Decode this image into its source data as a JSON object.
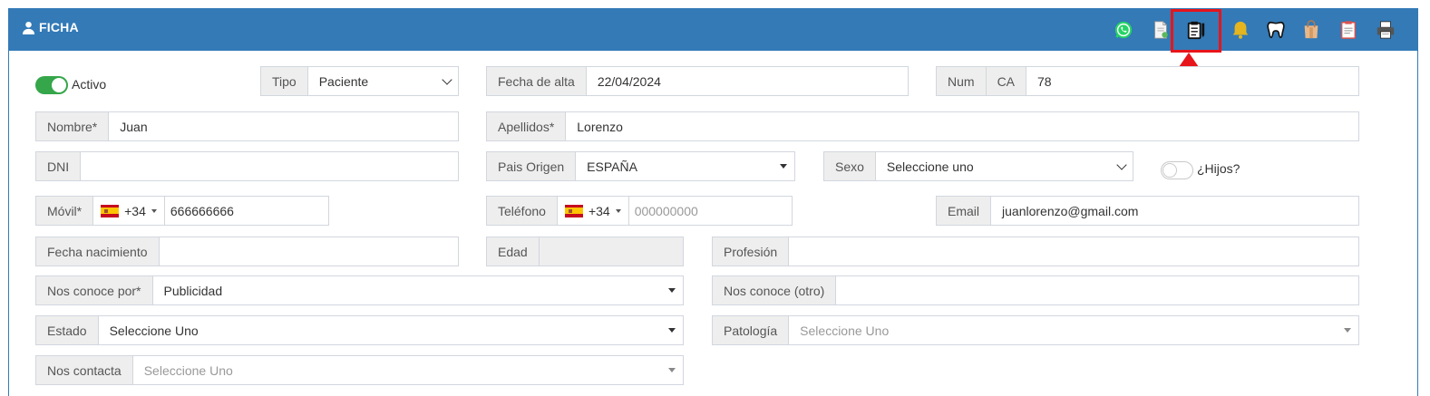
{
  "header": {
    "title": "FICHA",
    "icons": [
      "whatsapp-icon",
      "document-icon",
      "clipboard-edit-icon",
      "bell-icon",
      "tooth-icon",
      "bag-icon",
      "clipboard-list-icon",
      "printer-icon"
    ]
  },
  "colors": {
    "header": "#337ab7",
    "highlight": "#e8141b",
    "toggle_on": "#35a64a"
  },
  "form": {
    "activo": {
      "label": "Activo",
      "checked": true
    },
    "tipo": {
      "label": "Tipo",
      "value": "Paciente"
    },
    "fecha_alta": {
      "label": "Fecha de alta",
      "value": "22/04/2024"
    },
    "num": {
      "label": "Num",
      "prefix": "CA",
      "value": "78"
    },
    "nombre": {
      "label": "Nombre*",
      "value": "Juan"
    },
    "apellidos": {
      "label": "Apellidos*",
      "value": "Lorenzo"
    },
    "dni": {
      "label": "DNI",
      "value": ""
    },
    "pais": {
      "label": "Pais Origen",
      "value": "ESPAÑA"
    },
    "sexo": {
      "label": "Sexo",
      "value": "Seleccione uno"
    },
    "hijos": {
      "label": "¿Hijos?",
      "checked": false
    },
    "movil": {
      "label": "Móvil*",
      "code": "+34",
      "value": "666666666"
    },
    "telefono": {
      "label": "Teléfono",
      "code": "+34",
      "placeholder": "000000000"
    },
    "email": {
      "label": "Email",
      "value": "juanlorenzo@gmail.com"
    },
    "fecha_nac": {
      "label": "Fecha nacimiento",
      "value": ""
    },
    "edad": {
      "label": "Edad",
      "value": ""
    },
    "profesion": {
      "label": "Profesión",
      "value": ""
    },
    "nos_conoce": {
      "label": "Nos conoce por*",
      "value": "Publicidad"
    },
    "nos_conoce_otro": {
      "label": "Nos conoce (otro)",
      "value": ""
    },
    "estado": {
      "label": "Estado",
      "value": "Seleccione Uno"
    },
    "patologia": {
      "label": "Patología",
      "placeholder": "Seleccione Uno"
    },
    "nos_contacta": {
      "label": "Nos contacta",
      "placeholder": "Seleccione Uno"
    }
  }
}
